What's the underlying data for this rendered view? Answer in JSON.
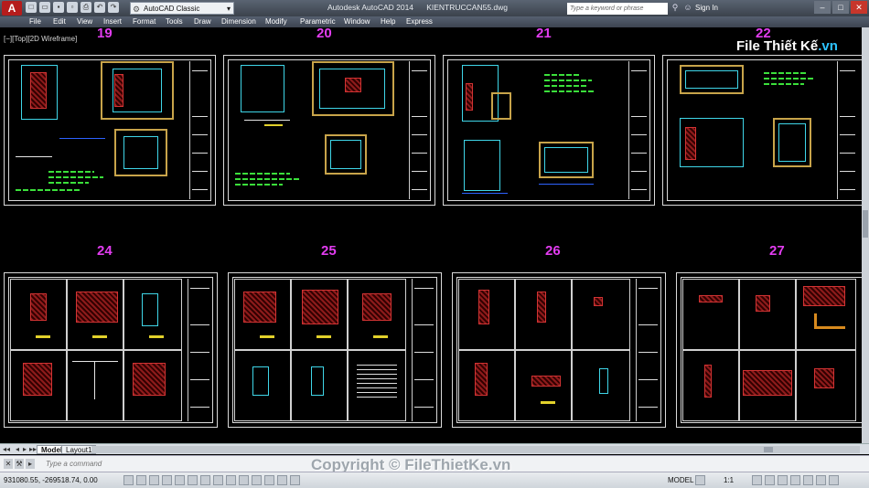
{
  "app": {
    "title": "Autodesk AutoCAD 2014      KIENTRUCCAN55.dwg",
    "workspace": "AutoCAD Classic",
    "search_placeholder": "Type a keyword or phrase",
    "sign_in": "Sign In",
    "logo_letter": "A"
  },
  "menu": [
    "File",
    "Edit",
    "View",
    "Insert",
    "Format",
    "Tools",
    "Draw",
    "Dimension",
    "Modify",
    "Parametric",
    "Window",
    "Help",
    "Express"
  ],
  "viewport": {
    "label": "[−][Top][2D Wireframe]"
  },
  "sheets": {
    "row1": [
      "19",
      "20",
      "21",
      "22"
    ],
    "row2": [
      "24",
      "25",
      "26",
      "27"
    ]
  },
  "watermark": {
    "brand": "File Thiết Kế",
    "tld": ".vn"
  },
  "tabs": {
    "model": "Model",
    "layout": "Layout1"
  },
  "command": {
    "placeholder": "Type a command"
  },
  "copyright": "Copyright © FileThietKe.vn",
  "status": {
    "coords": "931080.55, -269518.74, 0.00",
    "model": "MODEL",
    "scale": "1:1"
  },
  "colors": {
    "sheet_number": "#e23cf0",
    "canvas": "#000000",
    "accent": "#b51c1c"
  }
}
